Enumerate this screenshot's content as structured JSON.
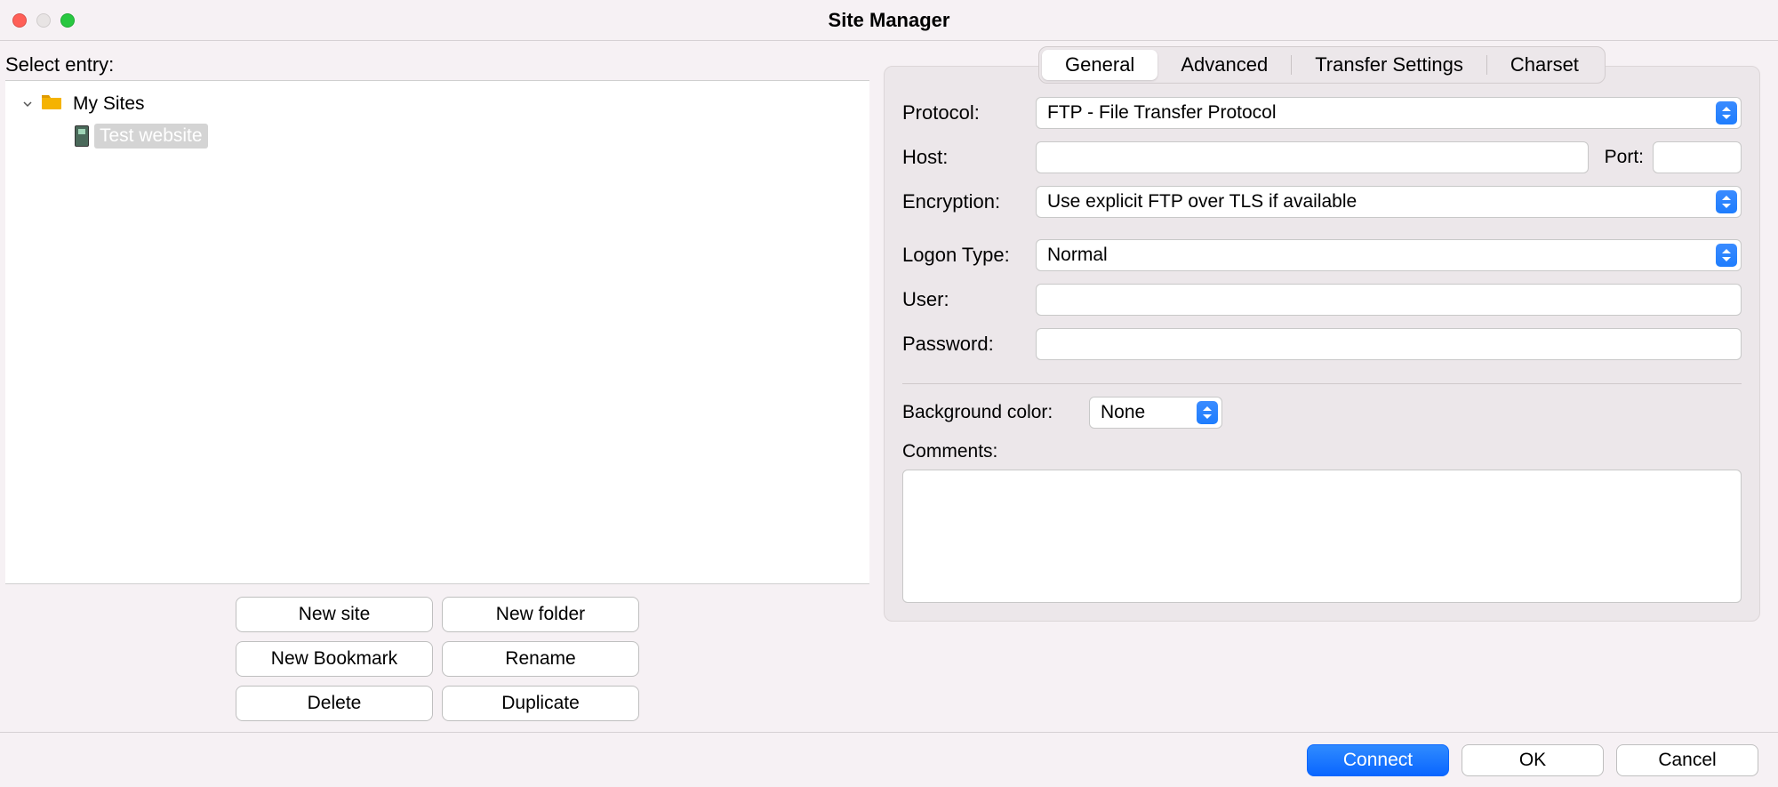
{
  "window": {
    "title": "Site Manager"
  },
  "left": {
    "select_entry_label": "Select entry:",
    "tree": {
      "root_label": "My Sites",
      "items": [
        {
          "label": "Test website",
          "selected": true
        }
      ]
    },
    "buttons": {
      "new_site": "New site",
      "new_folder": "New folder",
      "new_bookmark": "New Bookmark",
      "rename": "Rename",
      "delete": "Delete",
      "duplicate": "Duplicate"
    }
  },
  "tabs": {
    "general": "General",
    "advanced": "Advanced",
    "transfer": "Transfer Settings",
    "charset": "Charset",
    "active": "general"
  },
  "general": {
    "protocol_label": "Protocol:",
    "protocol_value": "FTP - File Transfer Protocol",
    "host_label": "Host:",
    "host_value": "",
    "port_label": "Port:",
    "port_value": "",
    "encryption_label": "Encryption:",
    "encryption_value": "Use explicit FTP over TLS if available",
    "logon_label": "Logon Type:",
    "logon_value": "Normal",
    "user_label": "User:",
    "user_value": "",
    "password_label": "Password:",
    "password_value": "",
    "bgcolor_label": "Background color:",
    "bgcolor_value": "None",
    "comments_label": "Comments:",
    "comments_value": ""
  },
  "footer": {
    "connect": "Connect",
    "ok": "OK",
    "cancel": "Cancel"
  }
}
